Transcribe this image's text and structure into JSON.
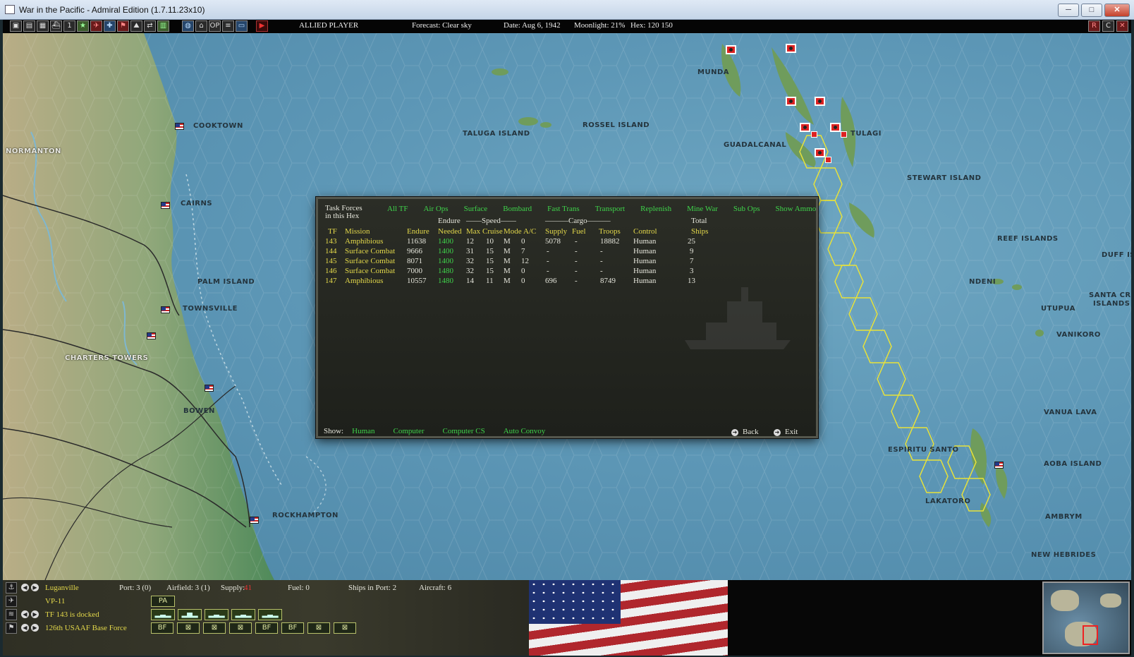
{
  "window": {
    "title": "War in the Pacific - Admiral Edition (1.7.11.23x10)",
    "buttons": [
      "─",
      "□",
      "✕"
    ]
  },
  "toolbar": {
    "player": "ALLIED PLAYER",
    "forecast": "Forecast: Clear sky",
    "date": "Date: Aug 6, 1942",
    "moonlight": "Moonlight: 21%",
    "hex": "Hex: 120 150",
    "icons": [
      "report-icon",
      "list-icon",
      "ships-icon",
      "groups-icon",
      "number-icon",
      "star-icon",
      "plane-icon",
      "air-icon",
      "flag-icon",
      "land-icon",
      "move-icon",
      "base-icon",
      "globe-icon",
      "save-icon",
      "op-icon",
      "menu-icon",
      "view-icon",
      "play-icon"
    ],
    "icon_glyphs": [
      "▣",
      "▤",
      "▦",
      "⛴",
      "1",
      "★",
      "✈",
      "✚",
      "⚑",
      "⛰",
      "⇄",
      "▥",
      "◍",
      "⌂",
      "OP",
      "≡",
      "▭",
      "▶"
    ],
    "right_icons": [
      "R",
      "C",
      "✕"
    ]
  },
  "map": {
    "places": [
      {
        "name": "COOKTOWN",
        "land": false
      },
      {
        "name": "NORMANTON",
        "land": true
      },
      {
        "name": "CAIRNS",
        "land": false
      },
      {
        "name": "PALM ISLAND",
        "land": false
      },
      {
        "name": "TOWNSVILLE",
        "land": false
      },
      {
        "name": "CHARTERS TOWERS",
        "land": true
      },
      {
        "name": "BOWEN",
        "land": false
      },
      {
        "name": "ROCKHAMPTON",
        "land": false
      },
      {
        "name": "TALUGA ISLAND",
        "land": false
      },
      {
        "name": "ROSSEL ISLAND",
        "land": false
      },
      {
        "name": "MUNDA",
        "land": false
      },
      {
        "name": "GUADALCANAL",
        "land": false
      },
      {
        "name": "TULAGI",
        "land": false
      },
      {
        "name": "STEWART ISLAND",
        "land": false
      },
      {
        "name": "REEF ISLANDS",
        "land": false
      },
      {
        "name": "DUFF IS",
        "land": false
      },
      {
        "name": "NDENI",
        "land": false
      },
      {
        "name": "SANTA CRU",
        "land": false
      },
      {
        "name": "ISLANDS",
        "land": false
      },
      {
        "name": "UTUPUA",
        "land": false
      },
      {
        "name": "VANIKORO",
        "land": false
      },
      {
        "name": "VANUA LAVA",
        "land": false
      },
      {
        "name": "ESPIRITU SANTO",
        "land": false
      },
      {
        "name": "AOBA ISLAND",
        "land": false
      },
      {
        "name": "LAKATORO",
        "land": false
      },
      {
        "name": "AMBRYM",
        "land": false
      },
      {
        "name": "NEW HEBRIDES",
        "land": false
      }
    ]
  },
  "task_forces": {
    "title_line1": "Task Forces",
    "title_line2": "in this Hex",
    "tabs": [
      "All TF",
      "Air Ops",
      "Surface",
      "Bombard",
      "Fast Trans",
      "Transport",
      "Replenish",
      "Mine War",
      "Sub Ops",
      "Show Ammo"
    ],
    "group_headers": {
      "endure": "Endure",
      "speed": "——Speed——",
      "cargo": "———Cargo———",
      "total": "Total"
    },
    "columns": [
      "TF",
      "Mission",
      "Endure",
      "Needed",
      "Max",
      "Cruise",
      "Mode",
      "A/C",
      "Supply",
      "Fuel",
      "Troops",
      "Control",
      "Ships"
    ],
    "rows": [
      {
        "tf": "143",
        "mission": "Amphibious",
        "endure": "11638",
        "needed": "1400",
        "max": "12",
        "cruise": "10",
        "mode": "M",
        "ac": "0",
        "supply": "5078",
        "fuel": "-",
        "troops": "18882",
        "control": "Human",
        "ships": "25"
      },
      {
        "tf": "144",
        "mission": "Surface Combat",
        "endure": "9666",
        "needed": "1400",
        "max": "31",
        "cruise": "15",
        "mode": "M",
        "ac": "7",
        "supply": "-",
        "fuel": "-",
        "troops": "-",
        "control": "Human",
        "ships": "9"
      },
      {
        "tf": "145",
        "mission": "Surface Combat",
        "endure": "8071",
        "needed": "1400",
        "max": "32",
        "cruise": "15",
        "mode": "M",
        "ac": "12",
        "supply": "-",
        "fuel": "-",
        "troops": "-",
        "control": "Human",
        "ships": "7"
      },
      {
        "tf": "146",
        "mission": "Surface Combat",
        "endure": "7000",
        "needed": "1480",
        "max": "32",
        "cruise": "15",
        "mode": "M",
        "ac": "0",
        "supply": "-",
        "fuel": "-",
        "troops": "-",
        "control": "Human",
        "ships": "3"
      },
      {
        "tf": "147",
        "mission": "Amphibious",
        "endure": "10557",
        "needed": "1480",
        "max": "14",
        "cruise": "11",
        "mode": "M",
        "ac": "0",
        "supply": "696",
        "fuel": "-",
        "troops": "8749",
        "control": "Human",
        "ships": "13"
      }
    ],
    "show_label": "Show:",
    "show_options": [
      "Human",
      "Computer",
      "Computer CS",
      "Auto Convoy"
    ],
    "back_label": "Back",
    "exit_label": "Exit"
  },
  "bottom": {
    "base": "Luganville",
    "port": "Port: 3 (0)",
    "airfield": "Airfield: 3 (1)",
    "supply_label": "Supply:",
    "supply_value": "41",
    "fuel": "Fuel: 0",
    "ships_in_port": "Ships in Port: 2",
    "aircraft": "Aircraft: 6",
    "air_unit": "VP-11",
    "air_unit_badge": "PA",
    "tf_status": "TF 143 is docked",
    "ground_unit": "126th USAAF Base Force",
    "ship_icons": [
      "▂▃▂",
      "▂▅▂",
      "▂▃▂",
      "▂▃▂",
      "▂▃▂"
    ],
    "unit_icons": [
      "BF",
      "⊠",
      "⊠",
      "⊠",
      "BF",
      "BF",
      "⊠",
      "⊠"
    ]
  },
  "colors": {
    "accent_green": "#3ed24a",
    "accent_yellow": "#e3d84a",
    "panel_bg": "#2b2d26",
    "sea": "#5d97b6"
  }
}
